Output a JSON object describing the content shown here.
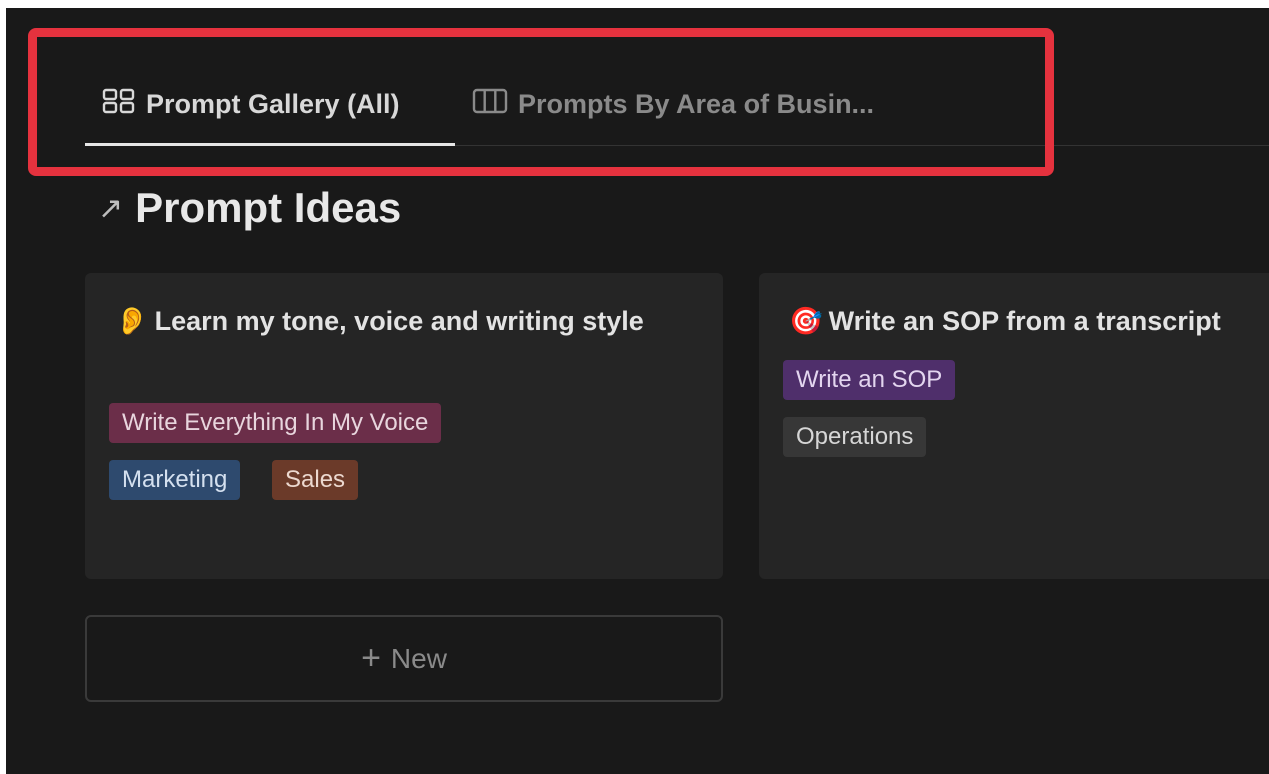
{
  "tabs": [
    {
      "label": "Prompt Gallery (All)",
      "icon": "gallery-grid-icon",
      "active": true
    },
    {
      "label": "Prompts By Area of Busin...",
      "icon": "board-columns-icon",
      "active": false
    }
  ],
  "section": {
    "title": "Prompt Ideas",
    "icon": "arrow-up-right-icon"
  },
  "cards": [
    {
      "emoji": "👂",
      "title": "Learn my tone, voice and writing style",
      "tags": [
        "Write Everything In My Voice",
        "Marketing",
        "Sales"
      ]
    },
    {
      "emoji": "🎯",
      "title": "Write an SOP from a transcript",
      "tags": [
        "Write an SOP",
        "Operations"
      ]
    }
  ],
  "new_button": {
    "label": "New",
    "icon": "plus-icon"
  },
  "colors": {
    "background": "#191919",
    "card": "#252525",
    "highlight": "#e5323e",
    "tag_voice": "#6b2e49",
    "tag_marketing": "#2e4a6e",
    "tag_sales": "#6b3a29",
    "tag_sop": "#4f2f6b",
    "tag_operations": "#373737"
  }
}
